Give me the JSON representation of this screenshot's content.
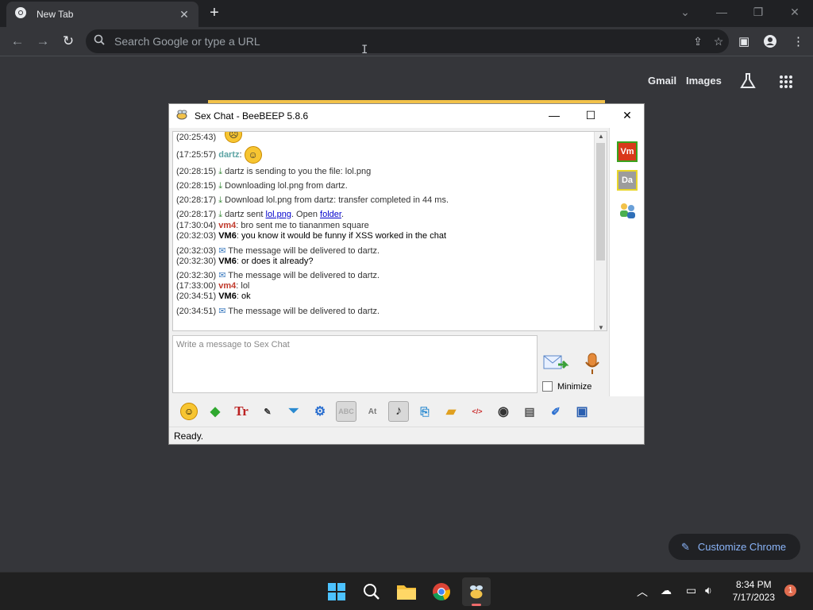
{
  "browser": {
    "tab_title": "New Tab",
    "omnibox_placeholder": "Search Google or type a URL",
    "links": {
      "gmail": "Gmail",
      "images": "Images"
    },
    "customize_label": "Customize Chrome"
  },
  "beebeep": {
    "window_title": "Sex Chat - BeeBEEP 5.8.6",
    "avatars": [
      {
        "label": "Vm",
        "color": "#d9391a",
        "border": "#39a31e"
      },
      {
        "label": "Da",
        "color": "#9c9c9c",
        "border": "#e8d52a"
      }
    ],
    "messages": [
      {
        "ts": "(20:25:43)",
        "kind": "emoji"
      },
      {
        "ts": "(17:25:57)",
        "nick": "dartz",
        "kind": "nick-emoji"
      },
      {
        "ts": "(20:28:15)",
        "text": "dartz is sending to you the file: lol.png",
        "kind": "file"
      },
      {
        "ts": "(20:28:15)",
        "text": "Downloading lol.png from dartz.",
        "kind": "file"
      },
      {
        "ts": "(20:28:17)",
        "text": "Download lol.png from dartz: transfer completed in 44 ms.",
        "kind": "file"
      },
      {
        "ts": "(20:28:17)",
        "text_pre": "dartz sent ",
        "link1": "lol.png",
        "text_mid": ". Open ",
        "link2": "folder",
        "text_post": ".",
        "kind": "file-link"
      },
      {
        "ts": "(17:30:04)",
        "nick": "vm4",
        "text": "bro sent me to tiananmen square",
        "kind": "vm4"
      },
      {
        "ts": "(20:32:03)",
        "nick": "VM6",
        "text": "you know it would be funny if XSS worked in the chat",
        "kind": "vm6"
      },
      {
        "ts": "(20:32:03)",
        "text": "The message will be delivered to dartz.",
        "kind": "mail"
      },
      {
        "ts": "(20:32:30)",
        "nick": "VM6",
        "text": "or does it already?",
        "kind": "vm6"
      },
      {
        "ts": "(20:32:30)",
        "text": "The message will be delivered to dartz.",
        "kind": "mail"
      },
      {
        "ts": "(17:33:00)",
        "nick": "vm4",
        "text": "lol",
        "kind": "vm4"
      },
      {
        "ts": "(20:34:51)",
        "nick": "VM6",
        "text": "ok",
        "kind": "vm6"
      },
      {
        "ts": "(20:34:51)",
        "text": "The message will be delivered to dartz.",
        "kind": "mail"
      }
    ],
    "compose_placeholder": "Write a message to Sex Chat",
    "minimize_label": "Minimize",
    "status": "Ready."
  },
  "taskbar": {
    "time": "8:34 PM",
    "date": "7/17/2023",
    "notifications": "1"
  }
}
